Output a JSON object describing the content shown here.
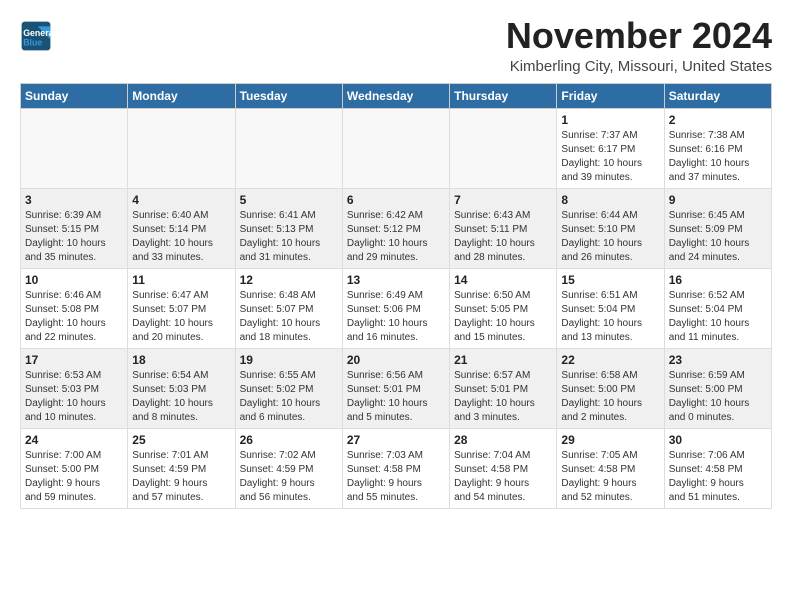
{
  "header": {
    "logo_line1": "General",
    "logo_line2": "Blue",
    "month": "November 2024",
    "location": "Kimberling City, Missouri, United States"
  },
  "weekdays": [
    "Sunday",
    "Monday",
    "Tuesday",
    "Wednesday",
    "Thursday",
    "Friday",
    "Saturday"
  ],
  "weeks": [
    [
      {
        "day": "",
        "info": "",
        "empty": true
      },
      {
        "day": "",
        "info": "",
        "empty": true
      },
      {
        "day": "",
        "info": "",
        "empty": true
      },
      {
        "day": "",
        "info": "",
        "empty": true
      },
      {
        "day": "",
        "info": "",
        "empty": true
      },
      {
        "day": "1",
        "info": "Sunrise: 7:37 AM\nSunset: 6:17 PM\nDaylight: 10 hours\nand 39 minutes."
      },
      {
        "day": "2",
        "info": "Sunrise: 7:38 AM\nSunset: 6:16 PM\nDaylight: 10 hours\nand 37 minutes."
      }
    ],
    [
      {
        "day": "3",
        "info": "Sunrise: 6:39 AM\nSunset: 5:15 PM\nDaylight: 10 hours\nand 35 minutes."
      },
      {
        "day": "4",
        "info": "Sunrise: 6:40 AM\nSunset: 5:14 PM\nDaylight: 10 hours\nand 33 minutes."
      },
      {
        "day": "5",
        "info": "Sunrise: 6:41 AM\nSunset: 5:13 PM\nDaylight: 10 hours\nand 31 minutes."
      },
      {
        "day": "6",
        "info": "Sunrise: 6:42 AM\nSunset: 5:12 PM\nDaylight: 10 hours\nand 29 minutes."
      },
      {
        "day": "7",
        "info": "Sunrise: 6:43 AM\nSunset: 5:11 PM\nDaylight: 10 hours\nand 28 minutes."
      },
      {
        "day": "8",
        "info": "Sunrise: 6:44 AM\nSunset: 5:10 PM\nDaylight: 10 hours\nand 26 minutes."
      },
      {
        "day": "9",
        "info": "Sunrise: 6:45 AM\nSunset: 5:09 PM\nDaylight: 10 hours\nand 24 minutes."
      }
    ],
    [
      {
        "day": "10",
        "info": "Sunrise: 6:46 AM\nSunset: 5:08 PM\nDaylight: 10 hours\nand 22 minutes."
      },
      {
        "day": "11",
        "info": "Sunrise: 6:47 AM\nSunset: 5:07 PM\nDaylight: 10 hours\nand 20 minutes."
      },
      {
        "day": "12",
        "info": "Sunrise: 6:48 AM\nSunset: 5:07 PM\nDaylight: 10 hours\nand 18 minutes."
      },
      {
        "day": "13",
        "info": "Sunrise: 6:49 AM\nSunset: 5:06 PM\nDaylight: 10 hours\nand 16 minutes."
      },
      {
        "day": "14",
        "info": "Sunrise: 6:50 AM\nSunset: 5:05 PM\nDaylight: 10 hours\nand 15 minutes."
      },
      {
        "day": "15",
        "info": "Sunrise: 6:51 AM\nSunset: 5:04 PM\nDaylight: 10 hours\nand 13 minutes."
      },
      {
        "day": "16",
        "info": "Sunrise: 6:52 AM\nSunset: 5:04 PM\nDaylight: 10 hours\nand 11 minutes."
      }
    ],
    [
      {
        "day": "17",
        "info": "Sunrise: 6:53 AM\nSunset: 5:03 PM\nDaylight: 10 hours\nand 10 minutes."
      },
      {
        "day": "18",
        "info": "Sunrise: 6:54 AM\nSunset: 5:03 PM\nDaylight: 10 hours\nand 8 minutes."
      },
      {
        "day": "19",
        "info": "Sunrise: 6:55 AM\nSunset: 5:02 PM\nDaylight: 10 hours\nand 6 minutes."
      },
      {
        "day": "20",
        "info": "Sunrise: 6:56 AM\nSunset: 5:01 PM\nDaylight: 10 hours\nand 5 minutes."
      },
      {
        "day": "21",
        "info": "Sunrise: 6:57 AM\nSunset: 5:01 PM\nDaylight: 10 hours\nand 3 minutes."
      },
      {
        "day": "22",
        "info": "Sunrise: 6:58 AM\nSunset: 5:00 PM\nDaylight: 10 hours\nand 2 minutes."
      },
      {
        "day": "23",
        "info": "Sunrise: 6:59 AM\nSunset: 5:00 PM\nDaylight: 10 hours\nand 0 minutes."
      }
    ],
    [
      {
        "day": "24",
        "info": "Sunrise: 7:00 AM\nSunset: 5:00 PM\nDaylight: 9 hours\nand 59 minutes."
      },
      {
        "day": "25",
        "info": "Sunrise: 7:01 AM\nSunset: 4:59 PM\nDaylight: 9 hours\nand 57 minutes."
      },
      {
        "day": "26",
        "info": "Sunrise: 7:02 AM\nSunset: 4:59 PM\nDaylight: 9 hours\nand 56 minutes."
      },
      {
        "day": "27",
        "info": "Sunrise: 7:03 AM\nSunset: 4:58 PM\nDaylight: 9 hours\nand 55 minutes."
      },
      {
        "day": "28",
        "info": "Sunrise: 7:04 AM\nSunset: 4:58 PM\nDaylight: 9 hours\nand 54 minutes."
      },
      {
        "day": "29",
        "info": "Sunrise: 7:05 AM\nSunset: 4:58 PM\nDaylight: 9 hours\nand 52 minutes."
      },
      {
        "day": "30",
        "info": "Sunrise: 7:06 AM\nSunset: 4:58 PM\nDaylight: 9 hours\nand 51 minutes."
      }
    ]
  ]
}
